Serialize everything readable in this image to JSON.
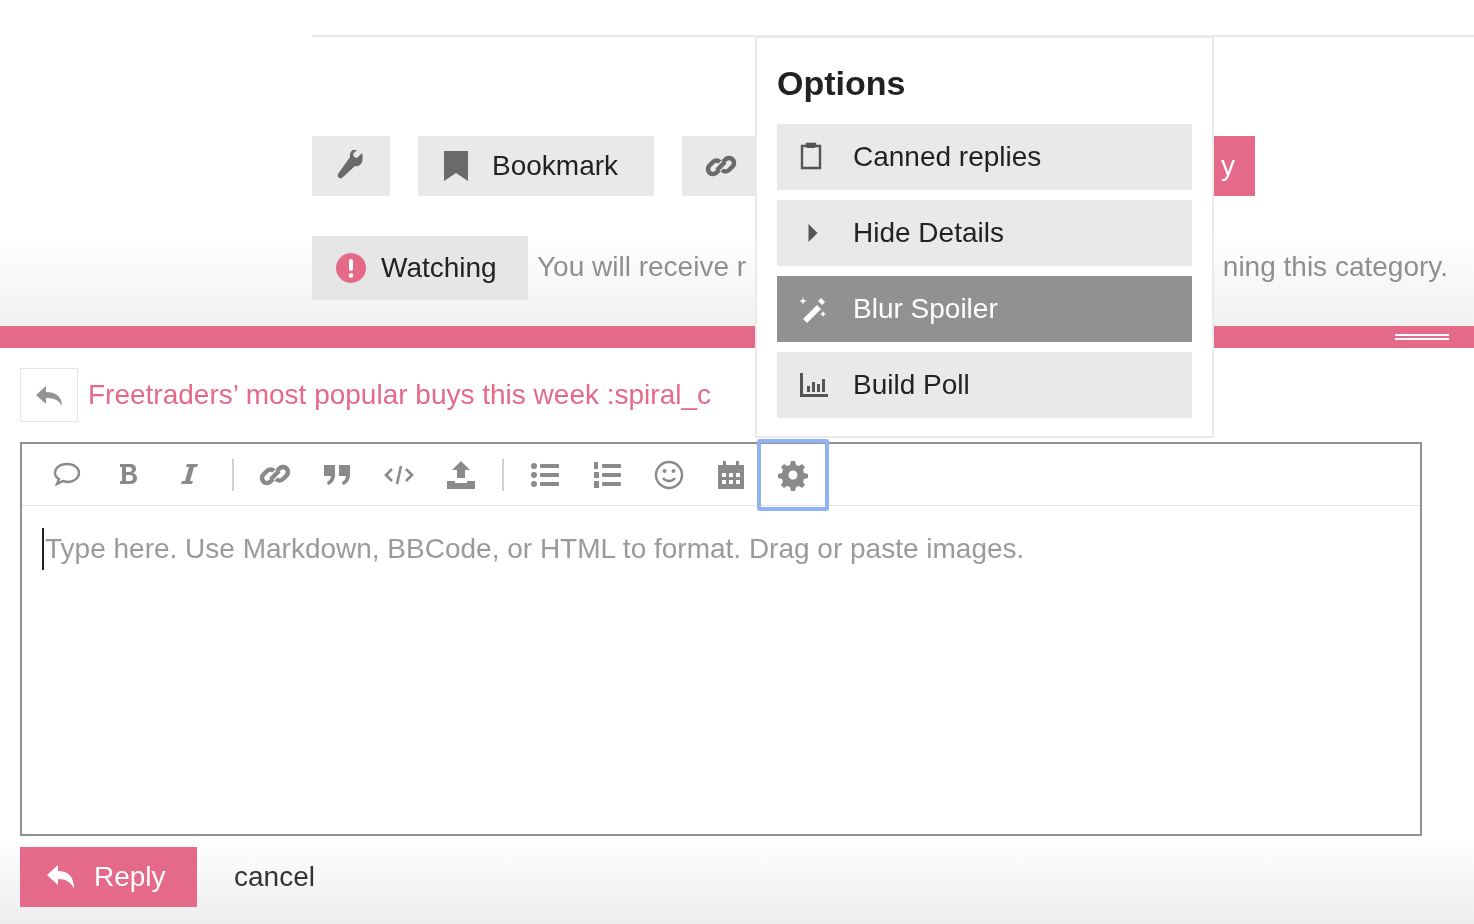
{
  "topic_buttons": [
    {
      "kind": "icon"
    },
    {
      "kind": "text",
      "label": "Bookmark"
    },
    {
      "kind": "icon"
    }
  ],
  "reply_fragment": "y",
  "notification": {
    "level": "Watching",
    "text_before": "You will receive r",
    "text_after": "ning this category."
  },
  "composer": {
    "title": "Freetraders’ most popular buys this week :spiral_c",
    "toolbar": [
      {
        "kind": "button",
        "selected": false
      },
      {
        "kind": "button",
        "selected": false
      },
      {
        "kind": "button",
        "selected": false
      },
      {
        "kind": "separator"
      },
      {
        "kind": "button",
        "selected": false
      },
      {
        "kind": "button",
        "selected": false
      },
      {
        "kind": "button",
        "selected": false
      },
      {
        "kind": "button",
        "selected": false
      },
      {
        "kind": "separator"
      },
      {
        "kind": "button",
        "selected": false
      },
      {
        "kind": "button",
        "selected": false
      },
      {
        "kind": "button",
        "selected": false
      },
      {
        "kind": "button",
        "selected": false
      },
      {
        "kind": "button",
        "selected": true
      }
    ],
    "placeholder": "Type here. Use Markdown, BBCode, or HTML to format. Drag or paste images.",
    "submit": "Reply",
    "cancel": "cancel"
  },
  "options_menu": {
    "title": "Options",
    "items": [
      {
        "label": "Canned replies",
        "selected": false
      },
      {
        "label": "Hide Details",
        "selected": false
      },
      {
        "label": "Blur Spoiler",
        "selected": true
      },
      {
        "label": "Build Poll",
        "selected": false
      }
    ]
  }
}
